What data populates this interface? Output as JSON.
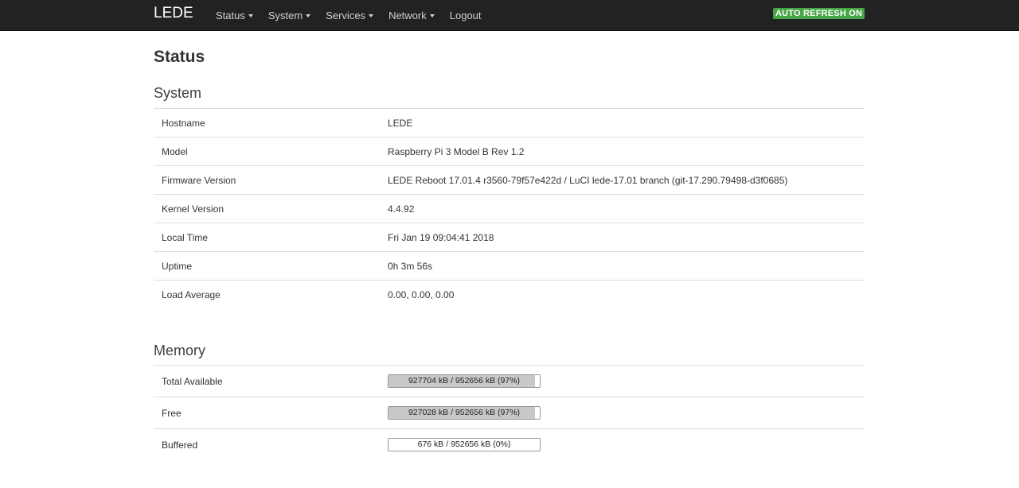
{
  "navbar": {
    "brand": "LEDE",
    "items": [
      {
        "label": "Status",
        "dropdown": true
      },
      {
        "label": "System",
        "dropdown": true
      },
      {
        "label": "Services",
        "dropdown": true
      },
      {
        "label": "Network",
        "dropdown": true
      },
      {
        "label": "Logout",
        "dropdown": false
      }
    ],
    "refresh_badge": "AUTO REFRESH ON"
  },
  "page_title": "Status",
  "system": {
    "title": "System",
    "rows": [
      {
        "label": "Hostname",
        "value": "LEDE"
      },
      {
        "label": "Model",
        "value": "Raspberry Pi 3 Model B Rev 1.2"
      },
      {
        "label": "Firmware Version",
        "value": "LEDE Reboot 17.01.4 r3560-79f57e422d / LuCI lede-17.01 branch (git-17.290.79498-d3f0685)"
      },
      {
        "label": "Kernel Version",
        "value": "4.4.92"
      },
      {
        "label": "Local Time",
        "value": "Fri Jan 19 09:04:41 2018"
      },
      {
        "label": "Uptime",
        "value": "0h 3m 56s"
      },
      {
        "label": "Load Average",
        "value": "0.00, 0.00, 0.00"
      }
    ]
  },
  "memory": {
    "title": "Memory",
    "rows": [
      {
        "label": "Total Available",
        "text": "927704 kB / 952656 kB (97%)",
        "percent": 97
      },
      {
        "label": "Free",
        "text": "927028 kB / 952656 kB (97%)",
        "percent": 97
      },
      {
        "label": "Buffered",
        "text": "676 kB / 952656 kB (0%)",
        "percent": 0
      }
    ]
  },
  "colors": {
    "navbar_bg": "#222222",
    "badge_bg": "#46a546",
    "bar_fill": "#c8c8c8"
  }
}
